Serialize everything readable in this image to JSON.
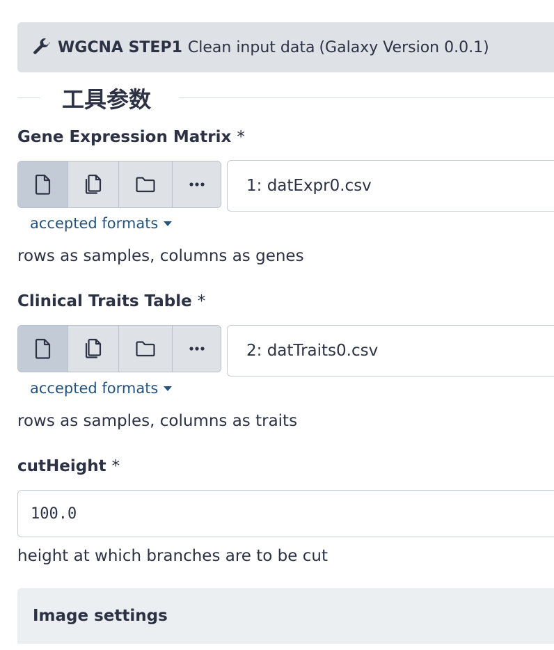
{
  "tool": {
    "name": "WGCNA STEP1",
    "description": "Clean input data",
    "version": "(Galaxy Version 0.0.1)"
  },
  "section_title": "工具参数",
  "required_marker": "*",
  "params": [
    {
      "label": "Gene Expression Matrix",
      "selected": "1: datExpr0.csv",
      "formats_link": "accepted formats",
      "help": "rows as samples, columns as genes"
    },
    {
      "label": "Clinical Traits Table",
      "selected": "2: datTraits0.csv",
      "formats_link": "accepted formats",
      "help": "rows as samples, columns as traits"
    },
    {
      "label": "cutHeight",
      "value": "100.0",
      "help": "height at which branches are to be cut"
    }
  ],
  "source_buttons": [
    "single-dataset-icon",
    "multiple-datasets-icon",
    "collection-folder-icon",
    "more-options-icon"
  ],
  "image_settings": {
    "title": "Image settings"
  },
  "colors": {
    "header_bg": "#dee2e6",
    "link": "#25537b",
    "active_button": "#c3ccd6",
    "text": "#2c3143"
  }
}
